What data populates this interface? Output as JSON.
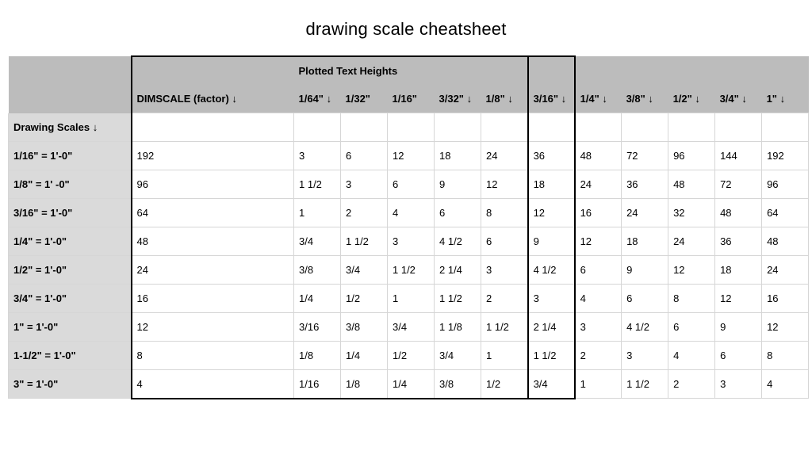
{
  "title": "drawing scale cheatsheet",
  "header": {
    "plotted_text_heights": "Plotted Text Heights",
    "dimscale": "DIMSCALE (factor)  ↓",
    "drawing_scales": "Drawing Scales ↓",
    "columns": [
      "1/64\" ↓",
      "1/32\"",
      "1/16\"",
      "3/32\" ↓",
      "1/8\" ↓",
      "3/16\" ↓",
      "1/4\" ↓",
      "3/8\" ↓",
      "1/2\" ↓",
      "3/4\" ↓",
      "1\" ↓"
    ]
  },
  "chart_data": {
    "type": "table",
    "row_scales": [
      "1/16\" = 1'-0\"",
      "1/8\" = 1' -0\"",
      "3/16\" = 1'-0\"",
      "1/4\" = 1'-0\"",
      "1/2\" = 1'-0\"",
      "3/4\" = 1'-0\"",
      "1\" = 1'-0\"",
      "1-1/2\" = 1'-0\"",
      "3\" = 1'-0\""
    ],
    "dimscale": [
      "192",
      "96",
      "64",
      "48",
      "24",
      "16",
      "12",
      "8",
      "4"
    ],
    "columns": [
      "1/64\"",
      "1/32\"",
      "1/16\"",
      "3/32\"",
      "1/8\"",
      "3/16\"",
      "1/4\"",
      "3/8\"",
      "1/2\"",
      "3/4\"",
      "1\""
    ],
    "values": [
      [
        "3",
        "6",
        "12",
        "18",
        "24",
        "36",
        "48",
        "72",
        "96",
        "144",
        "192"
      ],
      [
        "1 1/2",
        "3",
        "6",
        "9",
        "12",
        "18",
        "24",
        "36",
        "48",
        "72",
        "96"
      ],
      [
        "1",
        "2",
        "4",
        "6",
        "8",
        "12",
        "16",
        "24",
        "32",
        "48",
        "64"
      ],
      [
        "3/4",
        "1 1/2",
        "3",
        "4 1/2",
        "6",
        "9",
        "12",
        "18",
        "24",
        "36",
        "48"
      ],
      [
        "3/8",
        "3/4",
        "1 1/2",
        "2 1/4",
        "3",
        "4 1/2",
        "6",
        "9",
        "12",
        "18",
        "24"
      ],
      [
        "1/4",
        "1/2",
        "1",
        "1 1/2",
        "2",
        "3",
        "4",
        "6",
        "8",
        "12",
        "16"
      ],
      [
        "3/16",
        "3/8",
        "3/4",
        "1 1/8",
        "1 1/2",
        "2 1/4",
        "3",
        "4 1/2",
        "6",
        "9",
        "12"
      ],
      [
        "1/8",
        "1/4",
        "1/2",
        "3/4",
        "1",
        "1 1/2",
        "2",
        "3",
        "4",
        "6",
        "8"
      ],
      [
        "1/16",
        "1/8",
        "1/4",
        "3/8",
        "1/2",
        "3/4",
        "1",
        "1 1/2",
        "2",
        "3",
        "4"
      ]
    ],
    "highlight_columns": {
      "dimscale_and_first": [
        0,
        1
      ],
      "single": 6
    }
  }
}
